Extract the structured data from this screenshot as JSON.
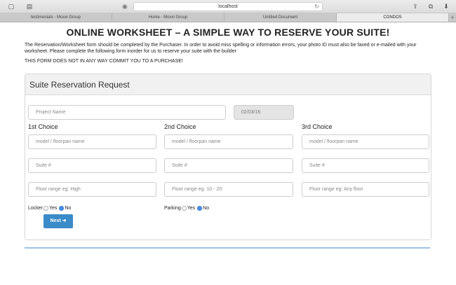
{
  "browser": {
    "url": "localhost",
    "tabs": [
      {
        "label": "testimonials - Moxxi Group",
        "active": false
      },
      {
        "label": "Home - Moxxi Group",
        "active": false
      },
      {
        "label": "Untitled Document",
        "active": false
      },
      {
        "label": "CONDOS",
        "active": true
      }
    ]
  },
  "page": {
    "title": "ONLINE WORKSHEET – A SIMPLE WAY TO RESERVE YOUR SUITE!",
    "intro": "The Reservation/Worksheet form should be completed by the Purchaser. In order to avoid miss spelling or information errors, your photo ID must also be faxed or e-mailed with your worksheet. Please complete the following form inorder for us to reserve your suite with the builder",
    "notice": "THIS FORM DOES NOT IN ANY WAY COMMIT YOU TO A PURCHASE!"
  },
  "form": {
    "heading": "Suite Reservation Request",
    "project_placeholder": "Project Name",
    "date_value": "02/03/16",
    "choices": [
      {
        "label": "1st Choice",
        "model": "model / floorpan name",
        "suite": "Suite #",
        "floor": "Floor range eg: High"
      },
      {
        "label": "2nd Choice",
        "model": "model / floorpan name",
        "suite": "Suite #",
        "floor": "Floor range eg: 10 - 20"
      },
      {
        "label": "3rd Choice",
        "model": "model / floorpan name",
        "suite": "Suite #",
        "floor": "Floor range eg: Any floor"
      }
    ],
    "locker": {
      "label": "Locker",
      "yes": "Yes",
      "no": "No",
      "selected": "No"
    },
    "parking": {
      "label": "Parking",
      "yes": "Yes",
      "no": "No",
      "selected": "No"
    },
    "next_label": "Next ➔"
  }
}
